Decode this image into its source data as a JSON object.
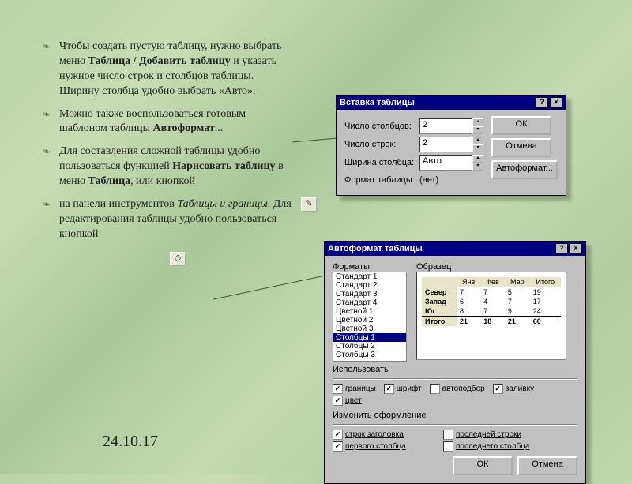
{
  "bullets": {
    "b1a": "Чтобы создать пустую таблицу, нужно выбрать меню ",
    "b1b": "Таблица / Добавить таблицу",
    "b1c": " и указать нужное число строк и столбцов таблицы. Ширину столбца удобно выбрать «Авто».",
    "b2a": "Можно также воспользоваться готовым шаблоном таблицы ",
    "b2b": "Автоформат",
    "b2c": "...",
    "b3a": "Для составления сложной таблицы удобно пользоваться функцией ",
    "b3b": "Нарисовать таблицу",
    "b3c": " в меню ",
    "b3d": "Таблица",
    "b3e": ", или кнопкой",
    "b4a": "на панели инструментов ",
    "b4b": "Таблицы и границы",
    "b4c": ". Для редактирования таблицы удобно пользоваться кнопкой"
  },
  "date": "24.10.17",
  "dlg_insert": {
    "title": "Вставка таблицы",
    "cols_label": "Число столбцов:",
    "cols_value": "2",
    "rows_label": "Число строк:",
    "rows_value": "2",
    "width_label": "Ширина столбца:",
    "width_value": "Авто",
    "format_label": "Формат таблицы:",
    "format_value": "(нет)",
    "ok": "ОК",
    "cancel": "Отмена",
    "autofmt": "Автоформат..."
  },
  "dlg_auto": {
    "title": "Автоформат таблицы",
    "formats_label": "Форматы:",
    "sample_label": "Образец",
    "items": [
      "Стандарт 1",
      "Стандарт 2",
      "Стандарт 3",
      "Стандарт 4",
      "Цветной 1",
      "Цветной 2",
      "Цветной 3",
      "Столбцы 1",
      "Столбцы 2",
      "Столбцы 3"
    ],
    "selected_index": 7,
    "use_label": "Использовать",
    "chk_borders": "границы",
    "chk_font": "шрифт",
    "chk_autofit": "автоподбор",
    "chk_fill": "заливку",
    "chk_color": "цвет",
    "change_label": "Изменить оформление",
    "chk_hdr_row": "строк заголовка",
    "chk_last_row": "последней строки",
    "chk_first_col": "первого столбца",
    "chk_last_col": "последнего столбца",
    "ok": "ОК",
    "cancel": "Отмена",
    "preview": {
      "headers": [
        "",
        "Янв",
        "Фев",
        "Мар",
        "Итого"
      ],
      "rows": [
        [
          "Север",
          "7",
          "7",
          "5",
          "19"
        ],
        [
          "Запад",
          "6",
          "4",
          "7",
          "17"
        ],
        [
          "Юг",
          "8",
          "7",
          "9",
          "24"
        ]
      ],
      "total": [
        "Итого",
        "21",
        "18",
        "21",
        "60"
      ]
    }
  },
  "icons": {
    "pencil": "✎",
    "eraser": "◇"
  }
}
